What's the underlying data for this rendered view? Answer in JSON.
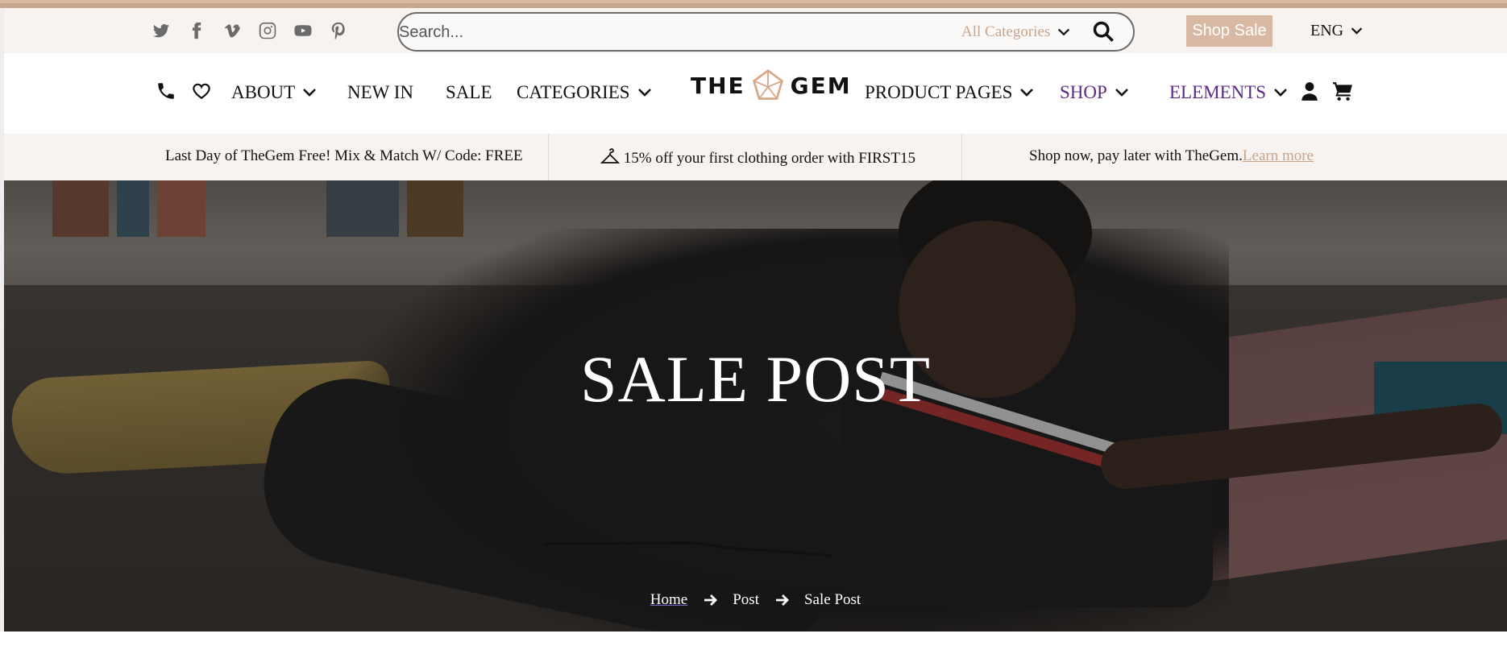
{
  "topbar": {
    "social_icons": [
      "twitter-icon",
      "facebook-icon",
      "vimeo-icon",
      "instagram-icon",
      "youtube-icon",
      "pinterest-icon"
    ],
    "search": {
      "placeholder": "Search...",
      "category_label": "All Categories"
    },
    "shop_sale_label": "Shop Sale",
    "language": "ENG"
  },
  "nav": {
    "about": "ABOUT",
    "new_in": "NEW IN",
    "sale": "SALE",
    "categories": "CATEGORIES",
    "logo_left": "THE",
    "logo_right": "GEM",
    "product_pages": "PRODUCT PAGES",
    "shop": "SHOP",
    "elements": "ELEMENTS"
  },
  "promo": {
    "item1": "Last Day of TheGem Free! Mix & Match W/ Code: FREE",
    "item2": "15% off your first clothing order with FIRST15",
    "item3": "Shop now, pay later with TheGem.",
    "item3_link": "Learn more"
  },
  "hero": {
    "title": "SALE POST",
    "breadcrumb": {
      "home": "Home",
      "post": "Post",
      "current": "Sale Post"
    }
  },
  "colors": {
    "accent": "#d9b9a3",
    "purple_nav": "#5b2a86",
    "topbar_bg": "#f7f3f1"
  }
}
